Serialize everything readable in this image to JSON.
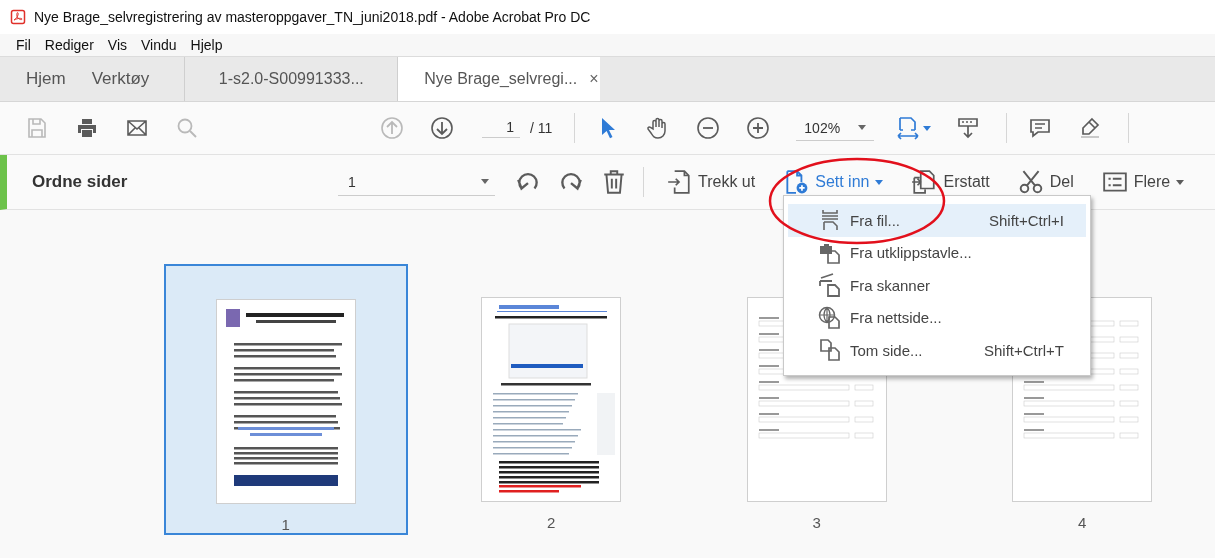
{
  "window": {
    "title": "Nye Brage_selvregistrering av masteroppgaver_TN_juni2018.pdf - Adobe Acrobat Pro DC"
  },
  "menu_bar": [
    "Fil",
    "Rediger",
    "Vis",
    "Vindu",
    "Hjelp"
  ],
  "tabs": [
    {
      "kind": "nav",
      "label": "Hjem",
      "selected": false
    },
    {
      "kind": "nav",
      "label": "Verktøy",
      "selected": false
    },
    {
      "kind": "document",
      "label": "1-s2.0-S00991333...",
      "selected": false
    },
    {
      "kind": "document",
      "label": "Nye Brage_selvregi...",
      "selected": true,
      "close": "×"
    }
  ],
  "toolbar": [
    {
      "kind": "save",
      "disabled": true
    },
    {
      "kind": "print",
      "disabled": false
    },
    {
      "kind": "mail",
      "disabled": false
    },
    {
      "kind": "search",
      "disabled": true
    },
    {
      "kind": "prev",
      "disabled": true
    },
    {
      "kind": "next",
      "disabled": false
    },
    {
      "kind": "page",
      "value": "1",
      "total": "/ 11"
    },
    {
      "kind": "separator"
    },
    {
      "kind": "select",
      "active": true
    },
    {
      "kind": "hand",
      "active": false
    },
    {
      "kind": "zoom_out",
      "disabled": false
    },
    {
      "kind": "zoom_in",
      "disabled": false
    },
    {
      "kind": "zoom",
      "value": "102%"
    },
    {
      "kind": "fit",
      "active": true
    },
    {
      "kind": "scroll",
      "disabled": false
    },
    {
      "kind": "separator"
    },
    {
      "kind": "comment",
      "disabled": false
    },
    {
      "kind": "highlight",
      "disabled": false
    },
    {
      "kind": "separator"
    }
  ],
  "organize_bar": {
    "title": "Ordne sider",
    "page_field": "1",
    "tools": [
      {
        "kind": "rotate_left"
      },
      {
        "kind": "rotate_right"
      },
      {
        "kind": "delete"
      }
    ],
    "actions": [
      {
        "kind": "extract",
        "label": "Trekk ut",
        "active": false,
        "dropdown": false
      },
      {
        "kind": "insert",
        "label": "Sett inn",
        "active": true,
        "dropdown": true
      },
      {
        "kind": "replace",
        "label": "Erstatt",
        "active": false,
        "dropdown": false
      },
      {
        "kind": "split",
        "label": "Del",
        "active": false,
        "dropdown": false
      },
      {
        "kind": "more",
        "label": "Flere",
        "active": false,
        "dropdown": true
      }
    ]
  },
  "insert_menu": [
    {
      "kind": "file",
      "label": "Fra fil...",
      "shortcut": "Shift+Ctrl+I",
      "selected": true
    },
    {
      "kind": "clipboard",
      "label": "Fra utklippstavle...",
      "selected": false
    },
    {
      "kind": "scanner",
      "label": "Fra skanner",
      "selected": false
    },
    {
      "kind": "web",
      "label": "Fra nettside...",
      "selected": false
    },
    {
      "kind": "blank",
      "label": "Tom side...",
      "shortcut": "Shift+Ctrl+T",
      "selected": false
    }
  ],
  "pages": [
    {
      "kind": "letter",
      "number": "1",
      "selected": true
    },
    {
      "kind": "web",
      "number": "2",
      "selected": false
    },
    {
      "kind": "form",
      "number": "3",
      "selected": false
    },
    {
      "kind": "form",
      "number": "4",
      "selected": false
    }
  ],
  "annotation": {
    "kind": "ellipse"
  }
}
